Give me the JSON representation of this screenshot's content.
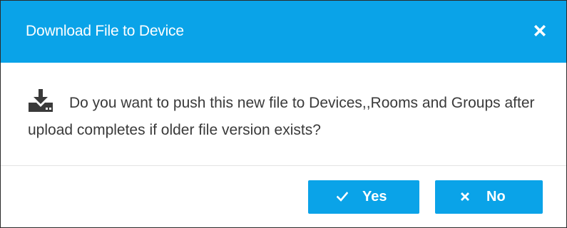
{
  "dialog": {
    "title": "Download File to Device",
    "close_icon": "close-icon",
    "message_icon": "download-icon",
    "message": "Do you want to push this new file to Devices,,Rooms and Groups after upload completes if older file version exists?",
    "buttons": {
      "yes_label": "Yes",
      "yes_icon": "check-icon",
      "no_label": "No",
      "no_icon": "close-icon"
    },
    "colors": {
      "accent": "#0aa3e8",
      "text": "#3a3a3a",
      "on_accent": "#ffffff"
    }
  }
}
